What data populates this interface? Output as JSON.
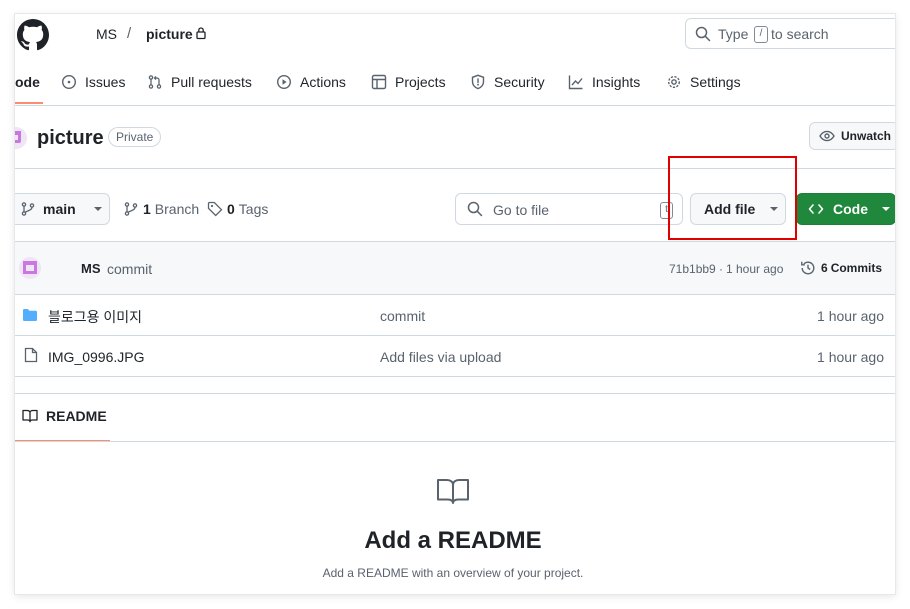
{
  "header": {
    "owner": "MS",
    "separator": "/",
    "repo": "picture",
    "search_prefix": "Type",
    "search_key": "/",
    "search_suffix": "to search"
  },
  "nav": {
    "tabs": [
      {
        "label": "ode",
        "icon": "code-icon"
      },
      {
        "label": "Issues",
        "icon": "issue-icon"
      },
      {
        "label": "Pull requests",
        "icon": "pull-request-icon"
      },
      {
        "label": "Actions",
        "icon": "play-icon"
      },
      {
        "label": "Projects",
        "icon": "table-icon"
      },
      {
        "label": "Security",
        "icon": "shield-icon"
      },
      {
        "label": "Insights",
        "icon": "graph-icon"
      },
      {
        "label": "Settings",
        "icon": "gear-icon"
      }
    ]
  },
  "repo_header": {
    "name": "picture",
    "visibility": "Private",
    "watch_label": "Unwatch"
  },
  "toolbar": {
    "branch": "main",
    "branch_count": "1",
    "branch_label": "Branch",
    "tag_count": "0",
    "tag_label": "Tags",
    "go_to_file_placeholder": "Go to file",
    "go_to_file_key": "t",
    "add_file_label": "Add file",
    "code_label": "Code"
  },
  "latest_commit": {
    "author": "MS",
    "message": "commit",
    "hash": "71b1bb9",
    "dot": "·",
    "time": "1 hour ago",
    "commits_count": "6",
    "commits_label": "Commits"
  },
  "files": [
    {
      "name": "블로그용 이미지",
      "type": "folder",
      "message": "commit",
      "time": "1 hour ago"
    },
    {
      "name": "IMG_0996.JPG",
      "type": "file",
      "message": "Add files via upload",
      "time": "1 hour ago"
    }
  ],
  "readme": {
    "tab_label": "README",
    "heading": "Add a README",
    "subtext": "Add a README with an overview of your project."
  },
  "colors": {
    "accent_underline": "#fd8c73",
    "code_button": "#1f883d",
    "folder": "#54aeff",
    "highlight_box": "#e00000"
  }
}
